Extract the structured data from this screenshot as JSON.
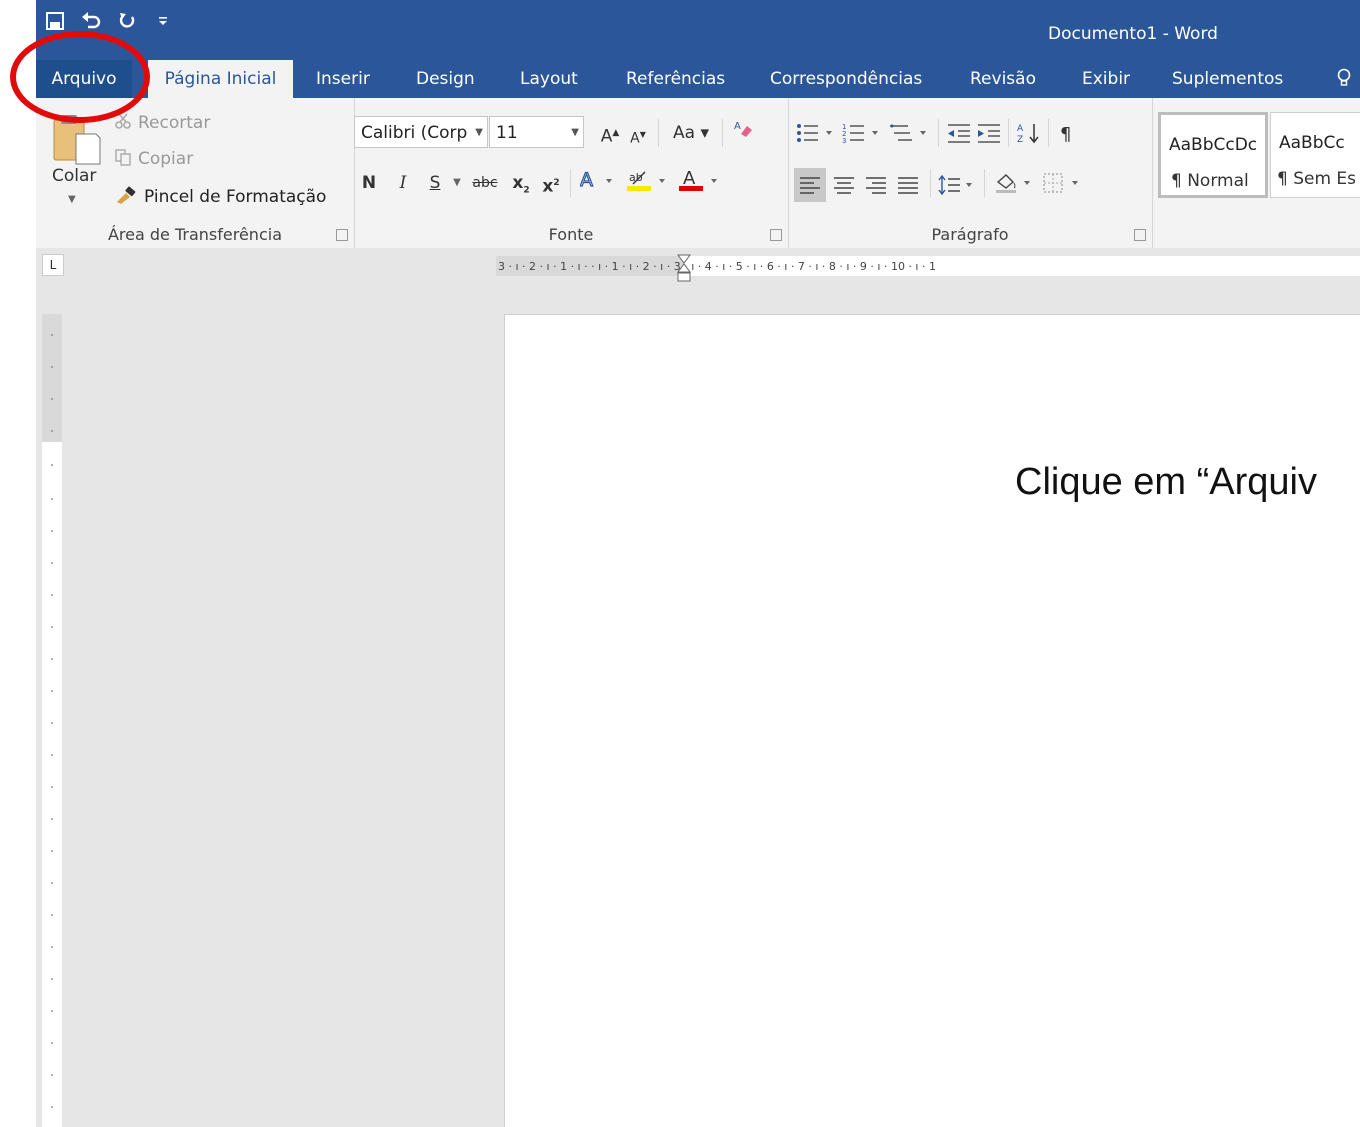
{
  "window": {
    "title": "Documento1 - Word"
  },
  "colors": {
    "accent": "#2b579a",
    "highlight": "#e10b0b"
  },
  "qat": {
    "icons": [
      "save-icon",
      "undo-icon",
      "redo-icon",
      "customize-icon"
    ]
  },
  "tabs": {
    "file": "Arquivo",
    "home": "Página Inicial",
    "insert": "Inserir",
    "design": "Design",
    "layout": "Layout",
    "references": "Referências",
    "mailings": "Correspondências",
    "review": "Revisão",
    "view": "Exibir",
    "addins": "Suplementos"
  },
  "clipboard": {
    "paste": "Colar",
    "cut": "Recortar",
    "copy": "Copiar",
    "format_painter": "Pincel de Formatação",
    "label": "Área de Transferência"
  },
  "font": {
    "name": "Calibri (Corp",
    "size": "11",
    "bold": "N",
    "italic": "I",
    "underline": "S",
    "strike": "abc",
    "case": "Aa",
    "label": "Fonte"
  },
  "paragraph": {
    "label": "Parágrafo"
  },
  "styles": {
    "items": [
      {
        "sample": "AaBbCcDc",
        "name": "¶ Normal"
      },
      {
        "sample": "AaBbCc",
        "name": "¶ Sem Es"
      }
    ]
  },
  "ruler": {
    "h_numbers": "3 · ı · 2 · ı · 1 · ı ·    · ı · 1 · ı · 2 · ı · 3 · ı · 4 · ı · 5 · ı · 6 · ı · 7 · ı · 8 · ı · 9 · ı · 10 · ı · 1"
  },
  "document": {
    "instruction": "Clique em “Arquiv"
  }
}
